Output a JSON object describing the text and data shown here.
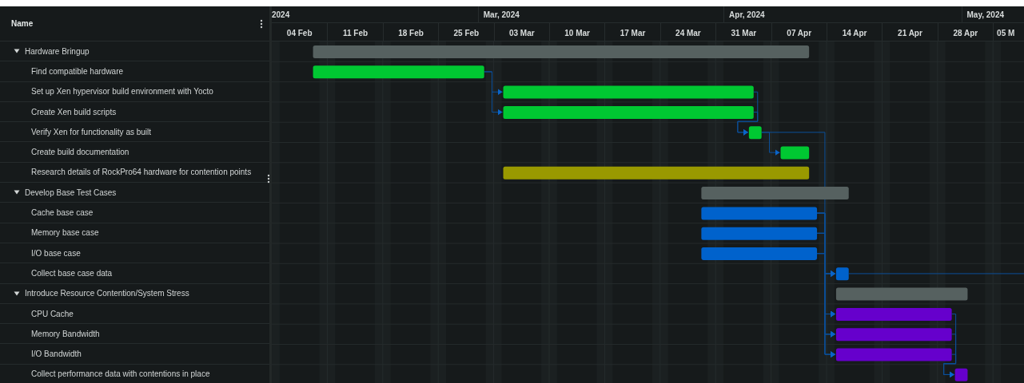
{
  "name_column": {
    "title": "Name"
  },
  "timeline": {
    "months": [
      "2024",
      "Mar, 2024",
      "Apr, 2024",
      "May, 2024"
    ],
    "weeks": [
      "04 Feb",
      "11 Feb",
      "18 Feb",
      "25 Feb",
      "03 Mar",
      "10 Mar",
      "17 Mar",
      "24 Mar",
      "31 Mar",
      "07 Apr",
      "14 Apr",
      "21 Apr",
      "28 Apr",
      "05 M"
    ]
  },
  "tasks": [
    {
      "name": "Hardware Bringup",
      "expanded": true,
      "color": "#566160",
      "children": [
        {
          "name": "Find compatible hardware",
          "color": "#00c832"
        },
        {
          "name": "Set up Xen hypervisor build environment with Yocto",
          "color": "#00c832"
        },
        {
          "name": "Create Xen build scripts",
          "color": "#00c832"
        },
        {
          "name": "Verify Xen for functionality as built",
          "color": "#00c832"
        },
        {
          "name": "Create build documentation",
          "color": "#00c832"
        },
        {
          "name": "Research details of RockPro64 hardware for contention points",
          "color": "#999900"
        }
      ]
    },
    {
      "name": "Develop Base Test Cases",
      "expanded": true,
      "color": "#566160",
      "children": [
        {
          "name": "Cache base case",
          "color": "#0062cc"
        },
        {
          "name": "Memory base case",
          "color": "#0062cc"
        },
        {
          "name": "I/O base case",
          "color": "#0062cc"
        },
        {
          "name": "Collect base case data",
          "color": "#0062cc"
        }
      ]
    },
    {
      "name": "Introduce Resource Contention/System Stress",
      "expanded": true,
      "color": "#566160",
      "children": [
        {
          "name": "CPU Cache",
          "color": "#6600cc"
        },
        {
          "name": "Memory Bandwidth",
          "color": "#6600cc"
        },
        {
          "name": "I/O Bandwidth",
          "color": "#6600cc"
        },
        {
          "name": "Collect performance data with contentions in place",
          "color": "#6600cc"
        }
      ]
    }
  ]
}
